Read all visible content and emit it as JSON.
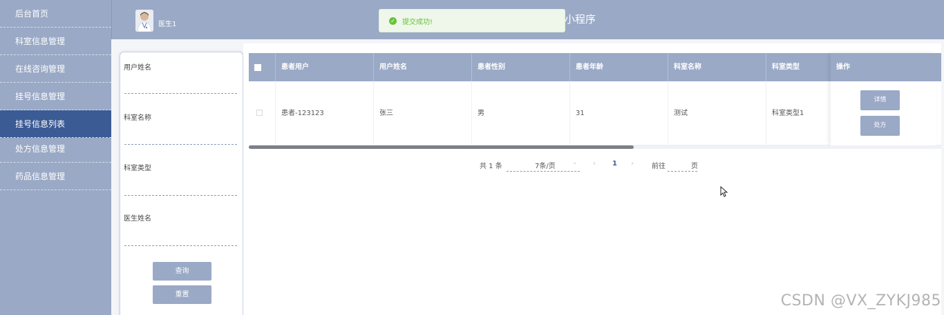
{
  "sidebar": {
    "items": [
      {
        "label": "后台首页",
        "active": false
      },
      {
        "label": "科室信息管理",
        "active": false
      },
      {
        "label": "在线咨询管理",
        "active": false
      },
      {
        "label": "挂号信息管理",
        "active": false
      },
      {
        "label": "挂号信息列表",
        "active": true
      },
      {
        "label": "处方信息管理",
        "active": false
      },
      {
        "label": "药品信息管理",
        "active": false
      }
    ]
  },
  "header": {
    "user_name": "医生1",
    "app_title": "小程序"
  },
  "toast": {
    "message": "提交成功!",
    "icon": "check-circle-icon"
  },
  "search": {
    "fields": [
      {
        "label": "用户姓名",
        "value": ""
      },
      {
        "label": "科室名称",
        "value": ""
      },
      {
        "label": "科室类型",
        "value": ""
      },
      {
        "label": "医生姓名",
        "value": ""
      }
    ],
    "query_button": "查询",
    "reset_button": "重置"
  },
  "table": {
    "columns": [
      "患者用户",
      "用户姓名",
      "患者性别",
      "患者年龄",
      "科室名称",
      "科室类型",
      "操作"
    ],
    "rows": [
      {
        "cells": [
          "患者-123123",
          "张三",
          "男",
          "31",
          "测试",
          "科室类型1"
        ],
        "actions": [
          "详情",
          "处方"
        ]
      }
    ]
  },
  "pagination": {
    "total_text": "共 1 条",
    "page_size": "7条/页",
    "current_page": "1",
    "goto_label": "前往",
    "goto_suffix": "页"
  },
  "watermark": "CSDN @VX_ZYKJ985"
}
